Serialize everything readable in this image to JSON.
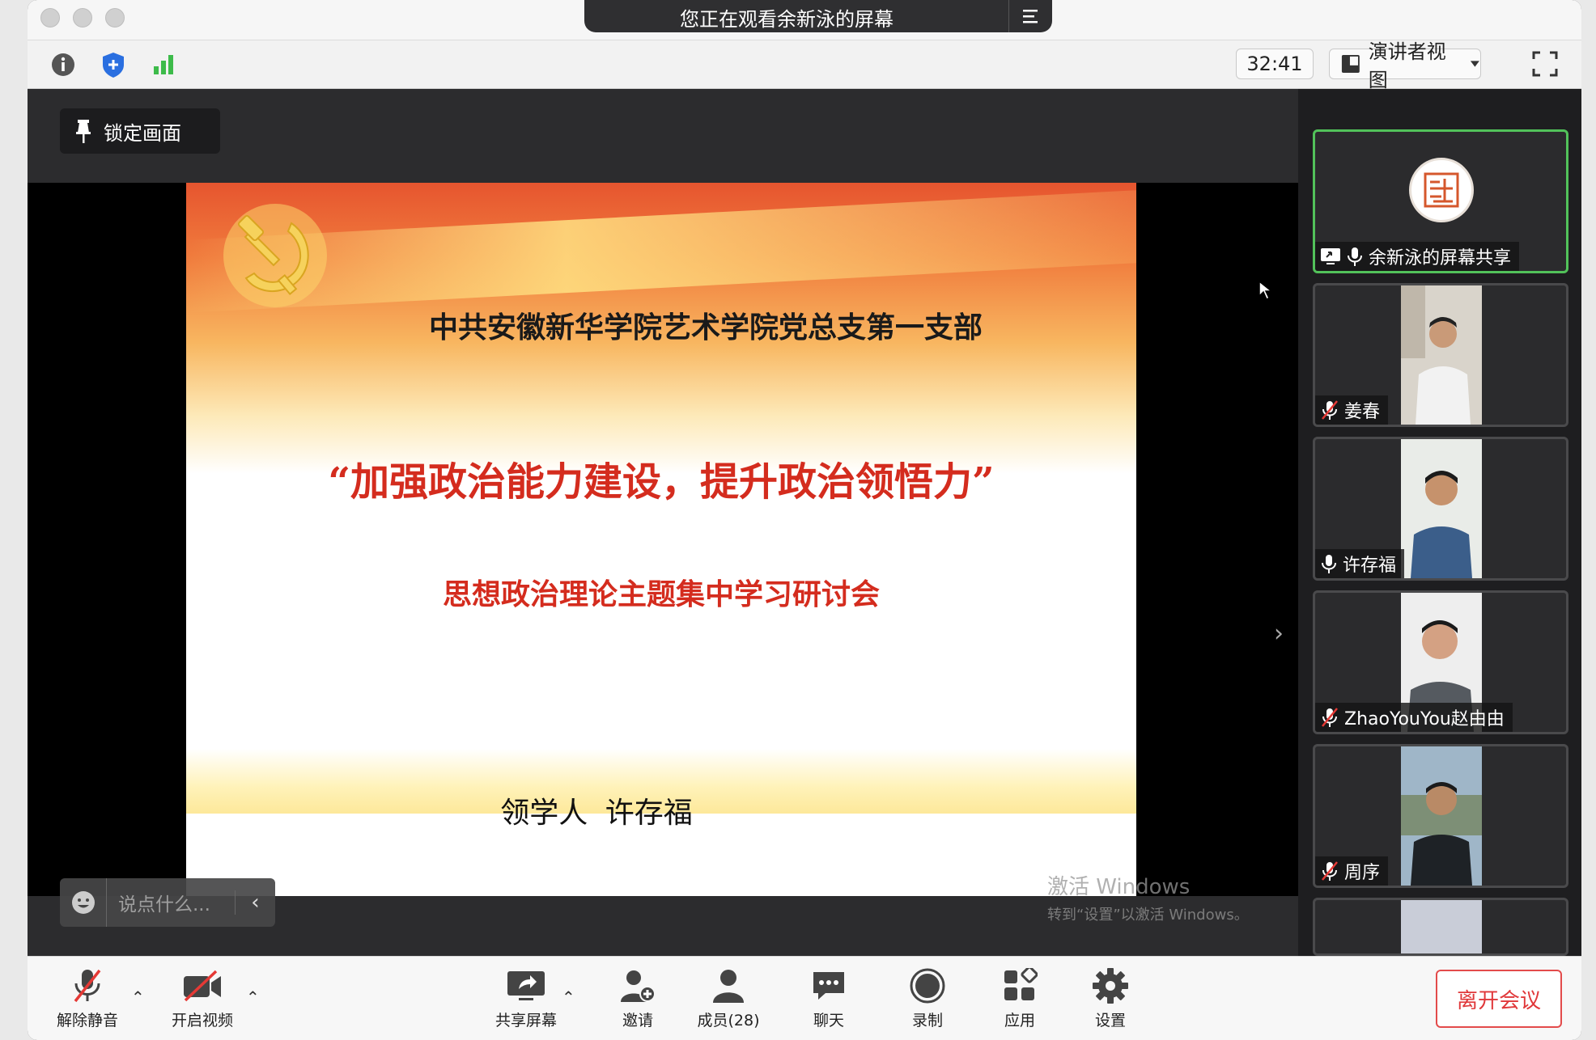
{
  "header": {
    "watching_text": "您正在观看余新泳的屏幕",
    "timer": "32:41",
    "view_mode": "演讲者视图"
  },
  "main": {
    "lock_label": "锁定画面",
    "chat_placeholder": "说点什么...",
    "slide": {
      "org": "中共安徽新华学院艺术学院党总支第一支部",
      "title": "“加强政治能力建设，提升政治领悟力”",
      "subtitle": "思想政治理论主题集中学习研讨会",
      "leader": "领学人  许存福"
    },
    "watermark": {
      "line1": "激活 Windows",
      "line2": "转到“设置”以激活 Windows。"
    }
  },
  "participants": [
    {
      "name": "余新泳的屏幕共享",
      "mic": "on",
      "active": true,
      "kind": "logo"
    },
    {
      "name": "姜春",
      "mic": "muted",
      "active": false,
      "kind": "video"
    },
    {
      "name": "许存福",
      "mic": "on",
      "active": false,
      "kind": "video"
    },
    {
      "name": "ZhaoYouYou赵由由",
      "mic": "muted",
      "active": false,
      "kind": "video"
    },
    {
      "name": "周序",
      "mic": "muted",
      "active": false,
      "kind": "video"
    }
  ],
  "bottom": {
    "unmute": "解除静音",
    "start_video": "开启视频",
    "share_screen": "共享屏幕",
    "invite": "邀请",
    "members": "成员(28)",
    "chat": "聊天",
    "record": "录制",
    "apps": "应用",
    "settings": "设置",
    "leave": "离开会议"
  },
  "colors": {
    "active_border": "#52c25a",
    "leave_red": "#e0383a",
    "slide_red": "#d42c1e"
  }
}
